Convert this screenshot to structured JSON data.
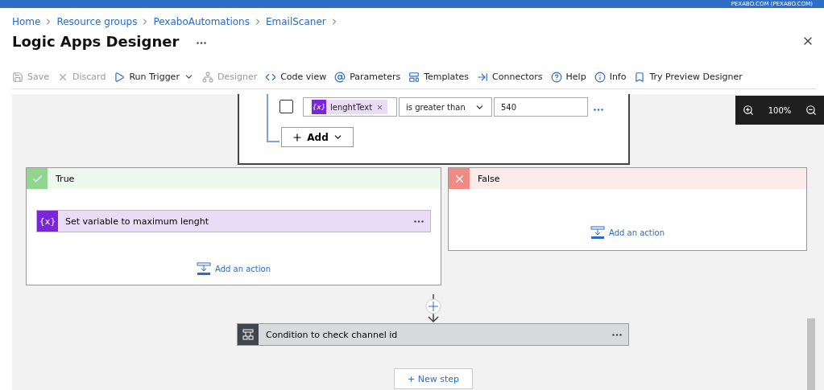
{
  "top_bar": {
    "account": "PEXABO.COM (PEXABO.COM)"
  },
  "breadcrumbs": [
    "Home",
    "Resource groups",
    "PexaboAutomations",
    "EmailScaner"
  ],
  "title": "Logic Apps Designer",
  "toolbar": [
    {
      "label": "Save",
      "disabled": true
    },
    {
      "label": "Discard",
      "disabled": true
    },
    {
      "label": "Run Trigger",
      "disabled": false
    },
    {
      "label": "Designer",
      "disabled": true
    },
    {
      "label": "Code view",
      "disabled": false
    },
    {
      "label": "Parameters",
      "disabled": false
    },
    {
      "label": "Templates",
      "disabled": false
    },
    {
      "label": "Connectors",
      "disabled": false
    },
    {
      "label": "Help",
      "disabled": false
    },
    {
      "label": "Info",
      "disabled": false
    },
    {
      "label": "Try Preview Designer",
      "disabled": false
    }
  ],
  "condition": {
    "checked": false,
    "token_icon": "{x}",
    "token": "lenghtText",
    "operator": "is greater than",
    "value": "540",
    "add_button": "Add"
  },
  "zoom": {
    "level": "100%"
  },
  "branches": [
    {
      "kind": "true",
      "title": "True",
      "actions": [
        {
          "icon": "{x}",
          "title": "Set variable to maximum lenght"
        }
      ],
      "add_action": "Add an action"
    },
    {
      "kind": "false",
      "title": "False",
      "add_action": "Add an action"
    }
  ],
  "next_step": {
    "title": "Condition to check channel id"
  },
  "new_step": "+ New step"
}
